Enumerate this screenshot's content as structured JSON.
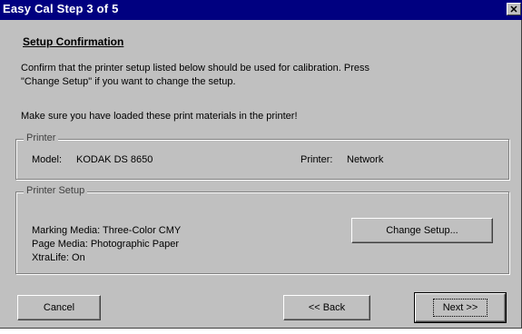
{
  "window": {
    "title": "Easy Cal Step 3 of 5",
    "close_label": "✕"
  },
  "heading": "Setup Confirmation",
  "instructions": {
    "line1": "Confirm that the printer setup listed below should be used for calibration.  Press",
    "line2": "\"Change Setup\" if you want to change the setup.",
    "materials": "Make sure you have loaded these print materials in the printer!"
  },
  "printer_group": {
    "label": "Printer",
    "model_label": "Model:",
    "model_value": "KODAK DS 8650",
    "port_label": "Printer:",
    "port_value": "Network"
  },
  "setup_group": {
    "label": "Printer Setup",
    "marking_media": "Marking Media: Three-Color CMY",
    "page_media": "Page Media: Photographic Paper",
    "xtralife": "XtraLife: On",
    "change_button": "Change Setup..."
  },
  "footer": {
    "cancel": "Cancel",
    "back": "<< Back",
    "next": "Next >>"
  }
}
